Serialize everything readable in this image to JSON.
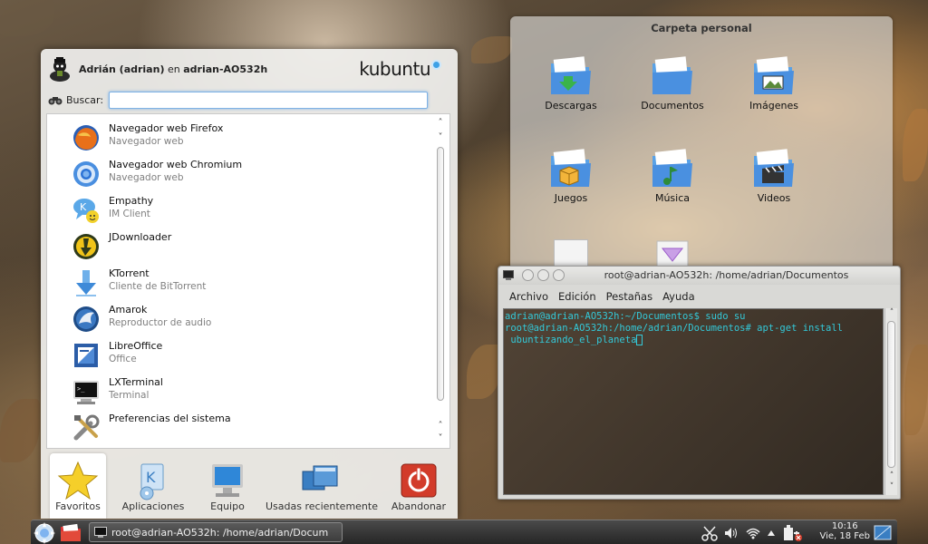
{
  "kickoff": {
    "user_name": "Adrián (adrian)",
    "user_sep": "en",
    "host": "adrian-AO532h",
    "brand": "kubuntu",
    "search_label": "Buscar:",
    "search_value": "",
    "apps": [
      {
        "name": "Navegador web Firefox",
        "desc": "Navegador web",
        "icon": "firefox-icon"
      },
      {
        "name": "Navegador web Chromium",
        "desc": "Navegador web",
        "icon": "chromium-icon"
      },
      {
        "name": "Empathy",
        "desc": "IM Client",
        "icon": "empathy-icon"
      },
      {
        "name": "JDownloader",
        "desc": "",
        "icon": "jdownloader-icon"
      },
      {
        "name": "KTorrent",
        "desc": "Cliente de BitTorrent",
        "icon": "ktorrent-icon"
      },
      {
        "name": "Amarok",
        "desc": "Reproductor de audio",
        "icon": "amarok-icon"
      },
      {
        "name": "LibreOffice",
        "desc": "Office",
        "icon": "libreoffice-icon"
      },
      {
        "name": "LXTerminal",
        "desc": "Terminal",
        "icon": "terminal-icon"
      },
      {
        "name": "Preferencias del sistema",
        "desc": "",
        "icon": "settings-tools-icon"
      }
    ],
    "tabs": [
      {
        "label": "Favoritos",
        "icon": "star-icon",
        "active": true
      },
      {
        "label": "Aplicaciones",
        "icon": "applications-icon",
        "active": false
      },
      {
        "label": "Equipo",
        "icon": "computer-icon",
        "active": false
      },
      {
        "label": "Usadas recientemente",
        "icon": "recent-windows-icon",
        "active": false
      },
      {
        "label": "Abandonar",
        "icon": "power-icon",
        "active": false
      }
    ]
  },
  "folder": {
    "title": "Carpeta personal",
    "items": [
      {
        "label": "Descargas",
        "icon": "folder-download-icon"
      },
      {
        "label": "Documentos",
        "icon": "folder-documents-icon"
      },
      {
        "label": "Imágenes",
        "icon": "folder-images-icon"
      },
      {
        "label": "Juegos",
        "icon": "folder-games-icon"
      },
      {
        "label": "Música",
        "icon": "folder-music-icon"
      },
      {
        "label": "Videos",
        "icon": "folder-videos-icon"
      }
    ]
  },
  "terminal": {
    "title": "root@adrian-AO532h: /home/adrian/Documentos",
    "menu": [
      "Archivo",
      "Edición",
      "Pestañas",
      "Ayuda"
    ],
    "lines": [
      "adrian@adrian-AO532h:~/Documentos$ sudo su",
      "root@adrian-AO532h:/home/adrian/Documentos# apt-get install",
      " ubuntizando_el_planeta"
    ]
  },
  "panel": {
    "task_label": "root@adrian-AO532h: /home/adrian/Docum",
    "clock_time": "10:16",
    "clock_date": "Vie, 18 Feb",
    "tray_icons": [
      "scissors-icon",
      "volume-icon",
      "wifi-icon",
      "tray-expand-icon",
      "battery-power-icon"
    ]
  },
  "colors": {
    "terminal_text": "#33c9d9",
    "kubuntu_accent": "#3ea1e6",
    "logout_red": "#d23b2a"
  }
}
